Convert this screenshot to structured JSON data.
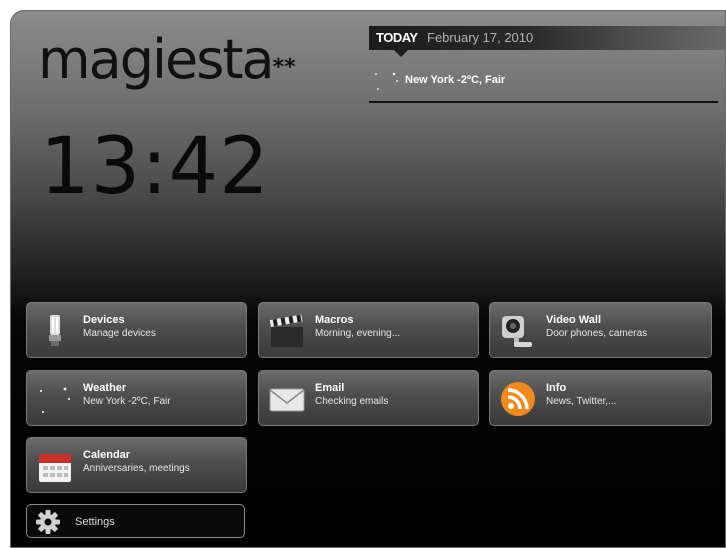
{
  "brand": {
    "name": "magiesta",
    "stars": "**"
  },
  "clock": {
    "time": "13:42"
  },
  "today": {
    "label": "TODAY",
    "date": "February 17, 2010",
    "weather": "New York -2ºC, Fair"
  },
  "tiles": [
    {
      "title": "Devices",
      "subtitle": "Manage devices",
      "icon": "light-bulb-icon"
    },
    {
      "title": "Macros",
      "subtitle": "Morning, evening...",
      "icon": "clapperboard-icon"
    },
    {
      "title": "Video Wall",
      "subtitle": "Door phones, cameras",
      "icon": "security-camera-icon"
    },
    {
      "title": "Weather",
      "subtitle": "New York -2ºC, Fair",
      "icon": "moon-stars-icon"
    },
    {
      "title": "Email",
      "subtitle": "Checking emails",
      "icon": "envelope-icon"
    },
    {
      "title": "Info",
      "subtitle": "News, Twitter,...",
      "icon": "rss-icon"
    },
    {
      "title": "Calendar",
      "subtitle": "Anniversaries, meetings",
      "icon": "calendar-icon"
    }
  ],
  "settings": {
    "label": "Settings",
    "icon": "gear-icon"
  },
  "colors": {
    "rss": "#f08a1d",
    "calendar_red": "#c8302a",
    "text": "#ffffff"
  }
}
